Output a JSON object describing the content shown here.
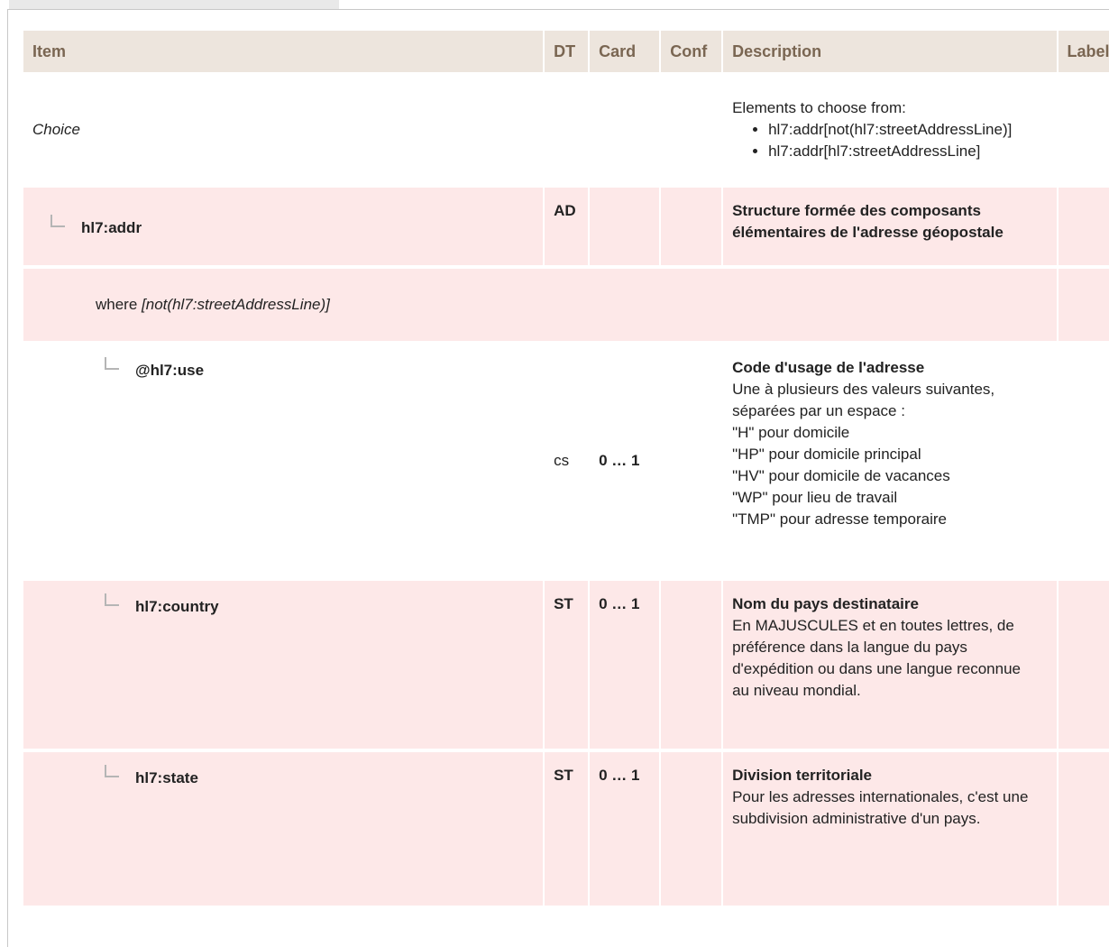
{
  "headers": {
    "item": "Item",
    "dt": "DT",
    "card": "Card",
    "conf": "Conf",
    "description": "Description",
    "label": "Label"
  },
  "choice": {
    "item": "Choice",
    "desc_intro": "Elements to choose from:",
    "options": [
      "hl7:addr[not(hl7:streetAddressLine)]",
      "hl7:addr[hl7:streetAddressLine]"
    ]
  },
  "addr": {
    "item": "hl7:addr",
    "dt": "AD",
    "description": "Structure formée des composants élémentaires de l'adresse géopostale"
  },
  "where": {
    "prefix": "where",
    "condition": "[not(hl7:streetAddressLine)]"
  },
  "use": {
    "item": "@hl7:use",
    "dt": "cs",
    "card": "0 … 1",
    "desc_title": "Code d'usage de l'adresse",
    "desc_lines": [
      "Une à plusieurs des valeurs suivantes,",
      "séparées par un espace :",
      "\"H\" pour domicile",
      "\"HP\" pour domicile principal",
      "\"HV\" pour domicile de vacances",
      "\"WP\" pour lieu de travail",
      "\"TMP\" pour adresse temporaire"
    ]
  },
  "country": {
    "item": "hl7:country",
    "dt": "ST",
    "card": "0 … 1",
    "desc_title": "Nom du pays destinataire",
    "desc_text": "En MAJUSCULES et en toutes lettres, de préférence dans la langue du pays d'expédition ou dans une langue reconnue au niveau mondial."
  },
  "state": {
    "item": "hl7:state",
    "dt": "ST",
    "card": "0 … 1",
    "desc_title": "Division territoriale",
    "desc_text": "Pour les adresses internationales, c'est une subdivision administrative d'un pays."
  }
}
